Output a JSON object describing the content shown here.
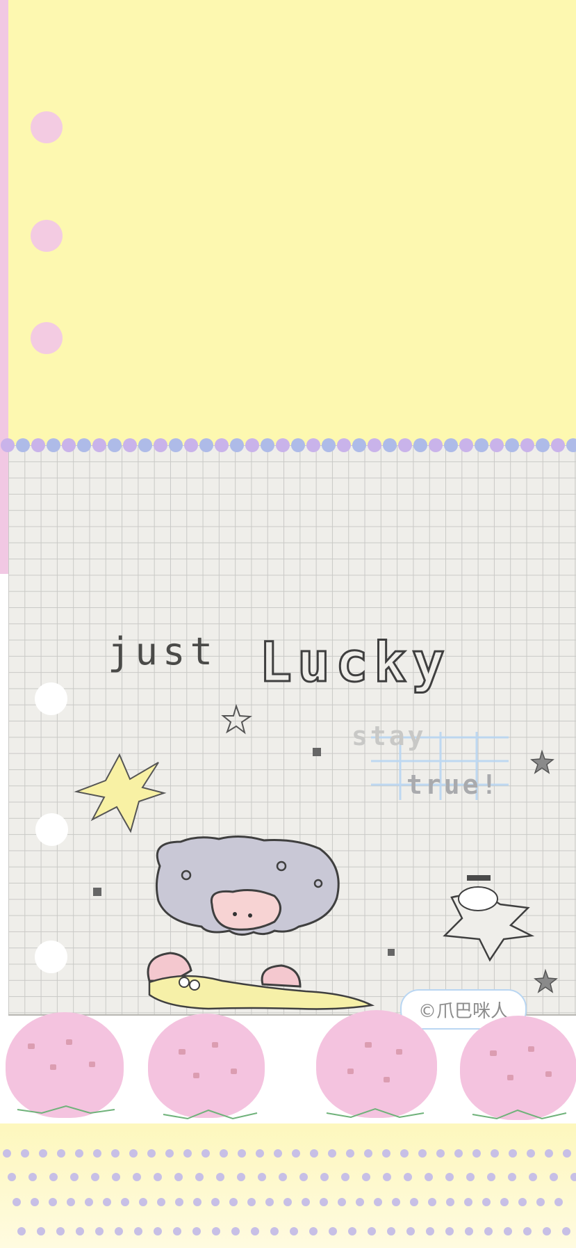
{
  "wallpaper": {
    "headline": {
      "word_one": "just",
      "word_two": "Lucky"
    },
    "stamp": {
      "line_one": "stay",
      "line_two": "true!"
    },
    "signature": "©爪巴咪人",
    "colors": {
      "top_yellow": "#fdf8b0",
      "left_pink": "#f1c8e3",
      "grid_paper": "#efeeea",
      "grid_line": "#c9c9c6",
      "bead_purple": "#c9b3ea",
      "bead_blue": "#aebbe8",
      "strawberry_pink": "#f4c3df",
      "cream_yellow": "#fdf7bd",
      "sketch_gray": "#3f3f3f",
      "star_yellow": "#f8f1a4",
      "stamp_blue": "#b9d6f2"
    }
  }
}
